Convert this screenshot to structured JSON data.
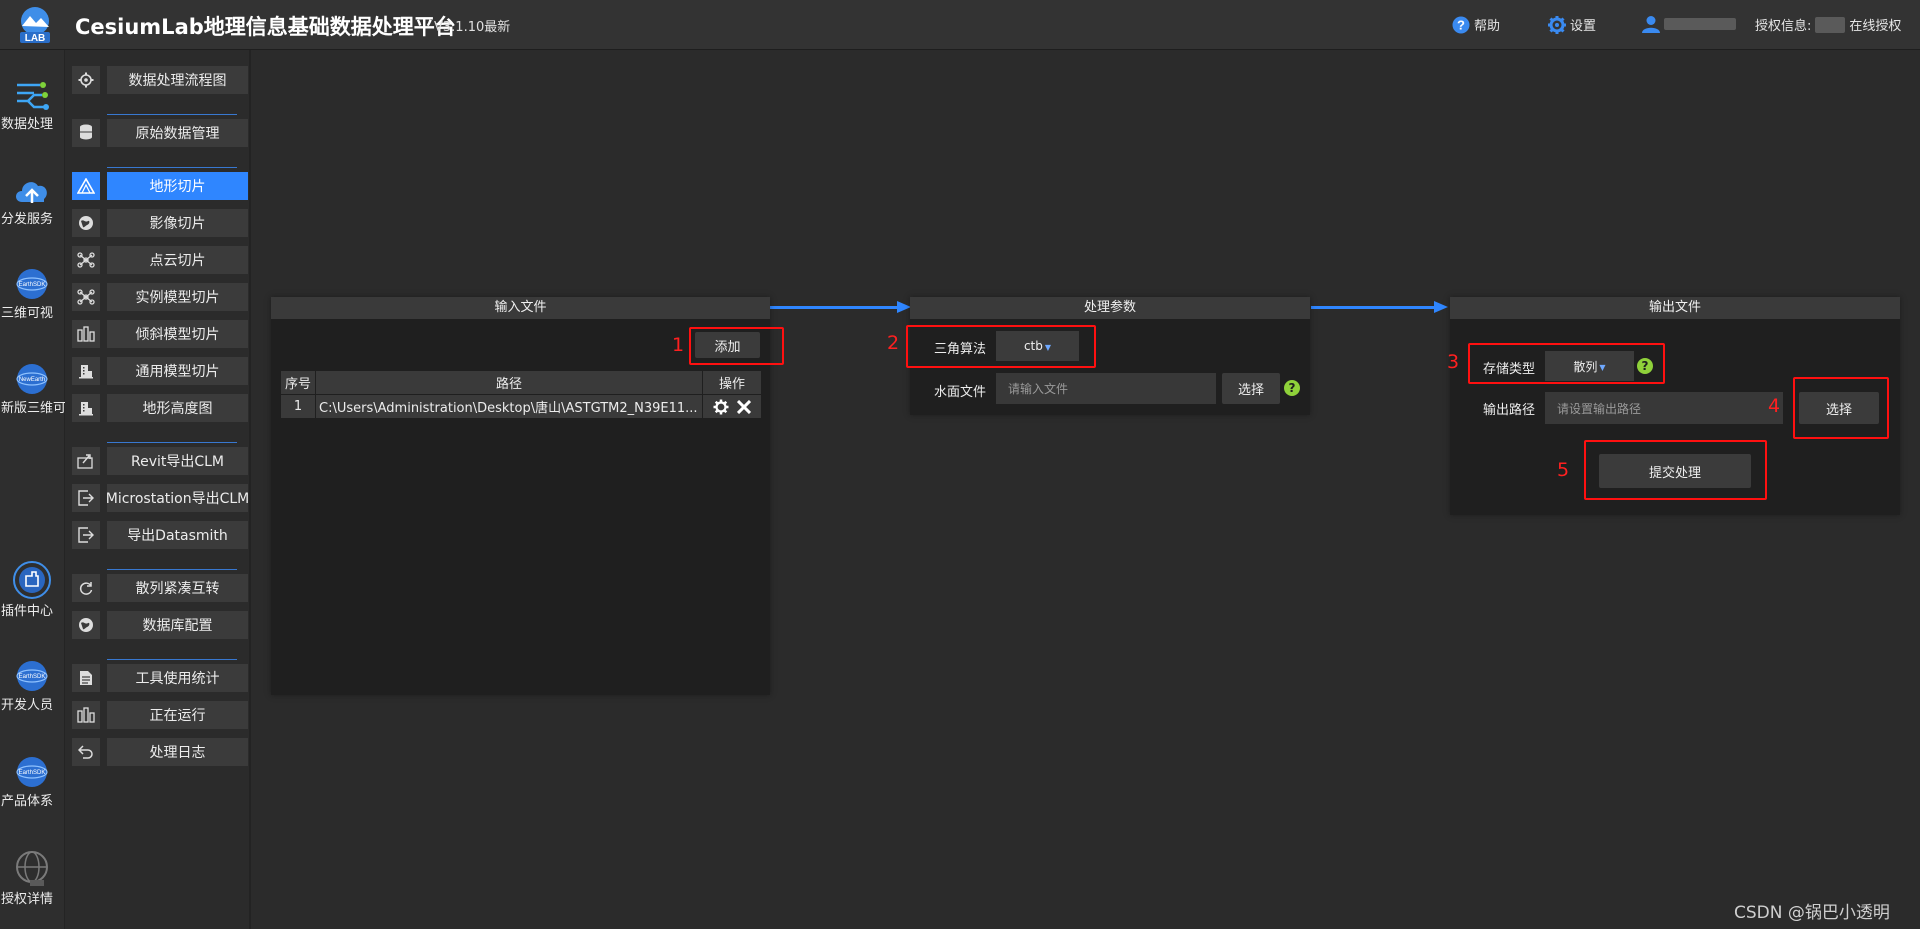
{
  "header": {
    "logo_text": "LAB",
    "title": "CesiumLab地理信息基础数据处理平台",
    "version": "V3.1.10最新",
    "help_label": "帮助",
    "settings_label": "设置",
    "license_label": "授权信息:",
    "license_status": "在线授权"
  },
  "rail": [
    {
      "label": "数据处理"
    },
    {
      "label": "分发服务"
    },
    {
      "label": "三维可视"
    },
    {
      "label": "新版三维可视"
    },
    {
      "label": "插件中心"
    },
    {
      "label": "开发人员"
    },
    {
      "label": "产品体系"
    },
    {
      "label": "授权详情"
    }
  ],
  "menu": [
    {
      "label": "数据处理流程图",
      "icon": "gear-icon"
    },
    {
      "label": "原始数据管理",
      "icon": "database-icon"
    },
    {
      "label": "地形切片",
      "icon": "terrain-icon",
      "active": true
    },
    {
      "label": "影像切片",
      "icon": "globe-icon"
    },
    {
      "label": "点云切片",
      "icon": "nodes-icon"
    },
    {
      "label": "实例模型切片",
      "icon": "nodes-icon"
    },
    {
      "label": "倾斜模型切片",
      "icon": "buildings-icon"
    },
    {
      "label": "通用模型切片",
      "icon": "building-icon"
    },
    {
      "label": "地形高度图",
      "icon": "building-icon"
    },
    {
      "label": "Revit导出CLM",
      "icon": "export-icon"
    },
    {
      "label": "Microstation导出CLM",
      "icon": "export-icon"
    },
    {
      "label": "导出Datasmith",
      "icon": "export-icon"
    },
    {
      "label": "散列紧凑互转",
      "icon": "refresh-icon"
    },
    {
      "label": "数据库配置",
      "icon": "globe-icon"
    },
    {
      "label": "工具使用统计",
      "icon": "document-icon"
    },
    {
      "label": "正在运行",
      "icon": "buildings-icon"
    },
    {
      "label": "处理日志",
      "icon": "undo-icon"
    }
  ],
  "input_panel": {
    "title": "输入文件",
    "add_button": "添加",
    "columns": [
      "序号",
      "路径",
      "操作"
    ],
    "rows": [
      {
        "index": "1",
        "path": "C:\\Users\\Administration\\Desktop\\唐山\\ASTGTM2_N39E11..."
      }
    ]
  },
  "params_panel": {
    "title": "处理参数",
    "algorithm_label": "三角算法",
    "algorithm_value": "ctb",
    "water_label": "水面文件",
    "water_placeholder": "请输入文件",
    "water_button": "选择"
  },
  "output_panel": {
    "title": "输出文件",
    "storage_label": "存储类型",
    "storage_value": "散列",
    "path_label": "输出路径",
    "path_placeholder": "请设置输出路径",
    "choose_button": "选择",
    "submit_button": "提交处理"
  },
  "annotations": [
    "1",
    "2",
    "3",
    "4",
    "5"
  ],
  "watermark": "CSDN @锅巴小透明",
  "colors": {
    "accent": "#2f86ff",
    "annotation": "#ff1010",
    "help": "#8fd13a"
  }
}
